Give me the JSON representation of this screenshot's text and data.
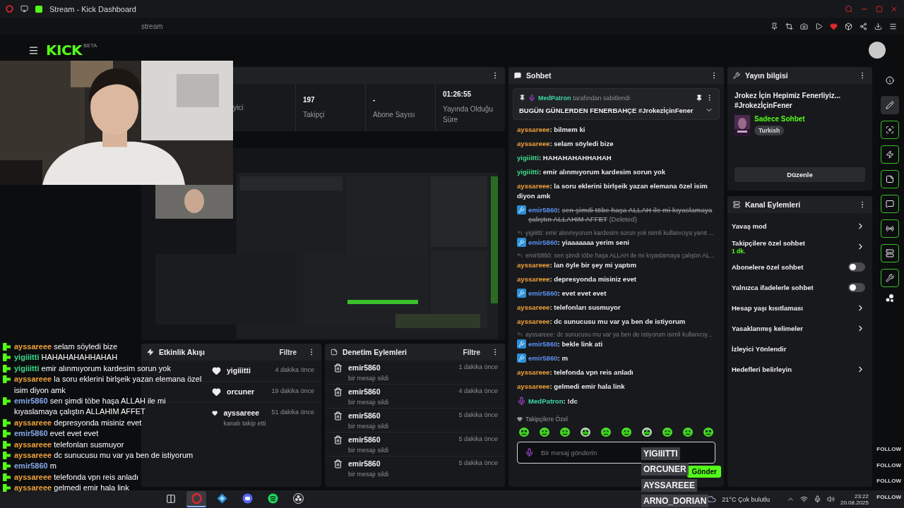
{
  "browser": {
    "tab_title": "Stream - Kick Dashboard",
    "address": "stream"
  },
  "header": {
    "logo": "KICK",
    "logo_tag": "BETA"
  },
  "stats": [
    {
      "label": "yici"
    },
    {
      "value": "197",
      "label": "Takipçi"
    },
    {
      "value": "-",
      "label": "Abone Sayısı"
    },
    {
      "value": "01:26:55",
      "label": "Yayında Olduğu Süre"
    }
  ],
  "activity": {
    "title": "Etkinlik Akışı",
    "filter": "Filtre",
    "items": [
      {
        "user": "yigiiitti",
        "time": "4 dakika önce"
      },
      {
        "user": "orcuner",
        "time": "19 dakika önce"
      },
      {
        "user": "ayssareee",
        "action": "kanalı takip etti",
        "time": "51 dakika önce"
      }
    ]
  },
  "moderation": {
    "title": "Denetim Eylemleri",
    "filter": "Filtre",
    "items": [
      {
        "user": "emir5860",
        "action": "bir mesajı sildi",
        "time": "1 dakika önce"
      },
      {
        "user": "emir5860",
        "action": "bir mesajı sildi",
        "time": "4 dakika önce"
      },
      {
        "user": "emir5860",
        "action": "bir mesajı sildi",
        "time": "5 dakika önce"
      },
      {
        "user": "emir5860",
        "action": "bir mesajı sildi",
        "time": "5 dakika önce"
      },
      {
        "user": "emir5860",
        "action": "bir mesajı sildi",
        "time": "5 dakika önce"
      }
    ]
  },
  "chat": {
    "title": "Sohbet",
    "pinned": {
      "user": "MedPatron",
      "note": "tarafından sabitlendi",
      "text": "BUGÜN GÜNLERDEN FENERBAHÇE #JrokezİçinFener"
    },
    "messages": [
      {
        "kind": "plain",
        "user": "ayssareee",
        "color": "#f0a23b",
        "text": ": bilmem ki"
      },
      {
        "kind": "plain",
        "user": "ayssareee",
        "color": "#f0a23b",
        "text": ": selam söyledi bize"
      },
      {
        "kind": "plain",
        "user": "yigiiitti",
        "color": "#3fdc8c",
        "text": ": HAHAHAHAHHAHAH"
      },
      {
        "kind": "plain",
        "user": "yigiiitti",
        "color": "#3fdc8c",
        "text": ": emir alınmıyorum kardesim sorun yok"
      },
      {
        "kind": "plain",
        "user": "ayssareee",
        "color": "#f0a23b",
        "text": ": la soru eklerini birlşeik yazan elemana özel isim diyon amk"
      },
      {
        "kind": "deleted",
        "user": "emir5860",
        "color": "#5b8ff0",
        "text": ":",
        "struck": "sen şimdi töbe haşa ALLAH ile mi kıyaslamaya çalıştın ALLAHIM AFFET",
        "note": "(Deleted)"
      },
      {
        "kind": "mod",
        "reply": "yigiiitti: emir alınmıyorum kardesim sorun yok isimli kullanıcıya yanıt ...",
        "user": "emir5860",
        "color": "#5b8ff0",
        "text": ": yiaaaaaaa yerim seni"
      },
      {
        "kind": "plain",
        "reply": "emir5860: sen şimdi töbe haşa ALLAH ile mi kıyaslamaya çalıştın AL...",
        "user": "ayssareee",
        "color": "#f0a23b",
        "text": ": lan öyle bir şey mi yaptım"
      },
      {
        "kind": "plain",
        "user": "ayssareee",
        "color": "#f0a23b",
        "text": ": depresyonda misiniz evet"
      },
      {
        "kind": "mod",
        "user": "emir5860",
        "color": "#5b8ff0",
        "text": ": evet evet evet"
      },
      {
        "kind": "plain",
        "user": "ayssareee",
        "color": "#f0a23b",
        "text": ": telefonları susmuyor"
      },
      {
        "kind": "plain",
        "user": "ayssareee",
        "color": "#f0a23b",
        "text": ": dc sunucusu mu var ya ben de istiyorum"
      },
      {
        "kind": "mod",
        "reply": "ayssareee: dc sunucusu mu var ya ben de istiyorum isimli kullanıcıy...",
        "user": "emir5860",
        "color": "#5b8ff0",
        "text": ": bekle link ati"
      },
      {
        "kind": "mod",
        "user": "emir5860",
        "color": "#5b8ff0",
        "text": ": m"
      },
      {
        "kind": "plain",
        "user": "ayssareee",
        "color": "#f0a23b",
        "text": ": telefonda vpn reis anladı"
      },
      {
        "kind": "plain",
        "user": "ayssareee",
        "color": "#f0a23b",
        "text": ": gelmedi emir hala link"
      },
      {
        "kind": "mic",
        "user": "MedPatron",
        "color": "#3fd7a4",
        "text": ": !dc"
      }
    ],
    "followers_label": "Takipçilere Özel",
    "input": {
      "placeholder": "Bir mesaj gönderin"
    },
    "send": "Gönder"
  },
  "stream_info": {
    "title": "Yayın bilgisi",
    "stream_title": "Jrokez İçin Hepimiz Fenerliyiz... #JrokezİçinFener",
    "category": "Sadece Sohbet",
    "tag": "Turkish",
    "edit": "Düzenle"
  },
  "channel_actions": {
    "title": "Kanal Eylemleri",
    "items": [
      {
        "kind": "link",
        "label": "Yavaş mod"
      },
      {
        "kind": "link",
        "label": "Takipçilere özel sohbet",
        "value": "1 dk."
      },
      {
        "kind": "toggle",
        "label": "Abonelere özel sohbet",
        "on": false
      },
      {
        "kind": "toggle",
        "label": "Yalnızca ifadelerle sohbet",
        "on": false
      },
      {
        "kind": "link",
        "label": "Hesap yaşı kısıtlaması"
      },
      {
        "kind": "link",
        "label": "Yasaklanmış kelimeler"
      },
      {
        "kind": "plain",
        "label": "İzleyici Yönlendir"
      },
      {
        "kind": "link",
        "label": "Hedefleri belirleyin"
      }
    ]
  },
  "rail": [
    {
      "kind": "plain",
      "selected": false
    },
    {
      "kind": "plain",
      "selected": true
    },
    {
      "kind": "shortcut",
      "selected": false
    },
    {
      "kind": "shortcut",
      "selected": false
    },
    {
      "kind": "shortcut",
      "selected": false
    },
    {
      "kind": "shortcut",
      "selected": false
    },
    {
      "kind": "shortcut",
      "selected": false
    },
    {
      "kind": "shortcut",
      "selected": false
    },
    {
      "kind": "shortcut",
      "selected": false
    },
    {
      "kind": "plain",
      "selected": false
    }
  ],
  "overlay_chat": [
    {
      "user": "ayssareee",
      "color": "#f0a23b",
      "text": "selam söyledi bize"
    },
    {
      "user": "yigiiitti",
      "color": "#3fdc8c",
      "text": "HAHAHAHAHHAHAH"
    },
    {
      "user": "yigiiitti",
      "color": "#3fdc8c",
      "text": "emir alınmıyorum kardesim sorun yok"
    },
    {
      "user": "ayssareee",
      "color": "#f0a23b",
      "text": "la soru eklerini birlşeik yazan elemana özel isim diyon amk"
    },
    {
      "user": "emir5860",
      "color": "#86a8e8",
      "text": "sen şimdi töbe haşa ALLAH ile mi kıyaslamaya çalıştın ALLAHIM AFFET"
    },
    {
      "user": "ayssareee",
      "color": "#f0a23b",
      "text": "depresyonda misiniz evet"
    },
    {
      "user": "emir5860",
      "color": "#86a8e8",
      "text": "evet evet evet"
    },
    {
      "user": "ayssareee",
      "color": "#f0a23b",
      "text": "telefonları susmuyor"
    },
    {
      "user": "ayssareee",
      "color": "#f0a23b",
      "text": "dc sunucusu mu var ya ben de istiyorum"
    },
    {
      "user": "emir5860",
      "color": "#86a8e8",
      "text": "m"
    },
    {
      "user": "ayssareee",
      "color": "#f0a23b",
      "text": "telefonda vpn reis anladı"
    },
    {
      "user": "ayssareee",
      "color": "#f0a23b",
      "text": "gelmedi emir hala link"
    }
  ],
  "follow_alerts": [
    {
      "name": "YIGIIITTI",
      "label": "FOLLOW"
    },
    {
      "name": "ORCUNER",
      "label": "FOLLOW"
    },
    {
      "name": "AYSSAREEE",
      "label": "FOLLOW"
    },
    {
      "name": "ARNO_DORIAN",
      "label": "FOLLOW"
    }
  ],
  "taskbar": {
    "apps": [
      {
        "selected": false
      },
      {
        "selected": true
      },
      {
        "selected": false
      },
      {
        "selected": false
      },
      {
        "selected": false
      },
      {
        "selected": false
      }
    ],
    "weather": "21°C Çok bulutlu",
    "time": "23:22",
    "date": "20.08.2025"
  }
}
